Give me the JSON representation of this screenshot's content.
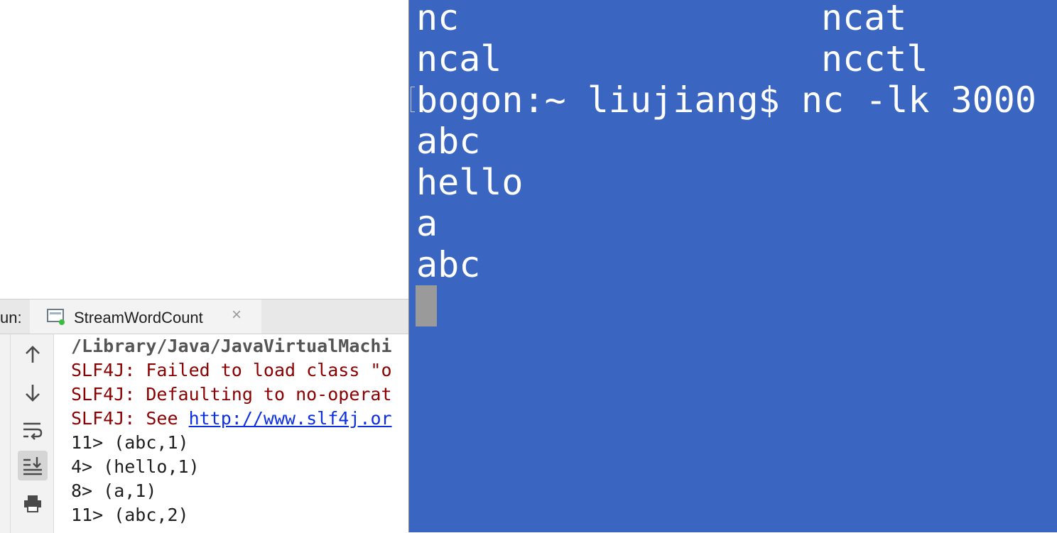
{
  "ide": {
    "run_panel": {
      "label": "un:",
      "tab": {
        "label": "StreamWordCount",
        "close_glyph": "×"
      },
      "toolbar": [
        "up-arrow-icon",
        "down-arrow-icon",
        "soft-wrap-icon",
        "scroll-to-end-icon",
        "print-icon"
      ],
      "console_lines": [
        {
          "text": "/Library/Java/JavaVirtualMachi",
          "kind": "path"
        },
        {
          "text": "SLF4J: Failed to load class \"o",
          "kind": "error"
        },
        {
          "text": "SLF4J: Defaulting to no-operat",
          "kind": "error"
        },
        {
          "prefix": "SLF4J: See ",
          "link": "http://www.slf4j.or",
          "kind": "error-link"
        },
        {
          "text": "11> (abc,1)",
          "kind": "output"
        },
        {
          "text": "4> (hello,1)",
          "kind": "output"
        },
        {
          "text": "8> (a,1)",
          "kind": "output"
        },
        {
          "text": "11> (abc,2)",
          "kind": "output"
        }
      ]
    }
  },
  "terminal": {
    "background": "#3a66c2",
    "completions": [
      {
        "left": "nc",
        "right": "ncat"
      },
      {
        "left": "ncal",
        "right": "ncctl"
      }
    ],
    "prompt": "bogon:~ liujiang$ nc -lk 3000",
    "input_lines": [
      "abc",
      "hello",
      "a",
      "abc"
    ]
  }
}
